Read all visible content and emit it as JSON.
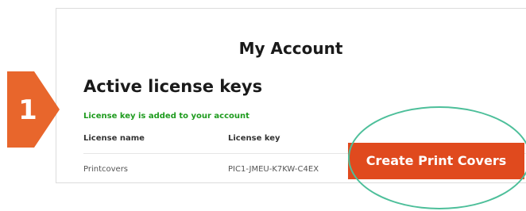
{
  "account": {
    "title": "My Account",
    "section_title": "Active license keys",
    "success_message": "License key is added to your account",
    "columns": [
      "License name",
      "License key"
    ],
    "rows": [
      {
        "name": "Printcovers",
        "key": "PIC1-JMEU-K7KW-C4EX"
      }
    ]
  },
  "step": {
    "number": "1",
    "color": "#e8662c"
  },
  "cta": {
    "label": "Create Print Covers",
    "color": "#e04a1e"
  },
  "highlight": {
    "color": "#4dbf9a"
  }
}
